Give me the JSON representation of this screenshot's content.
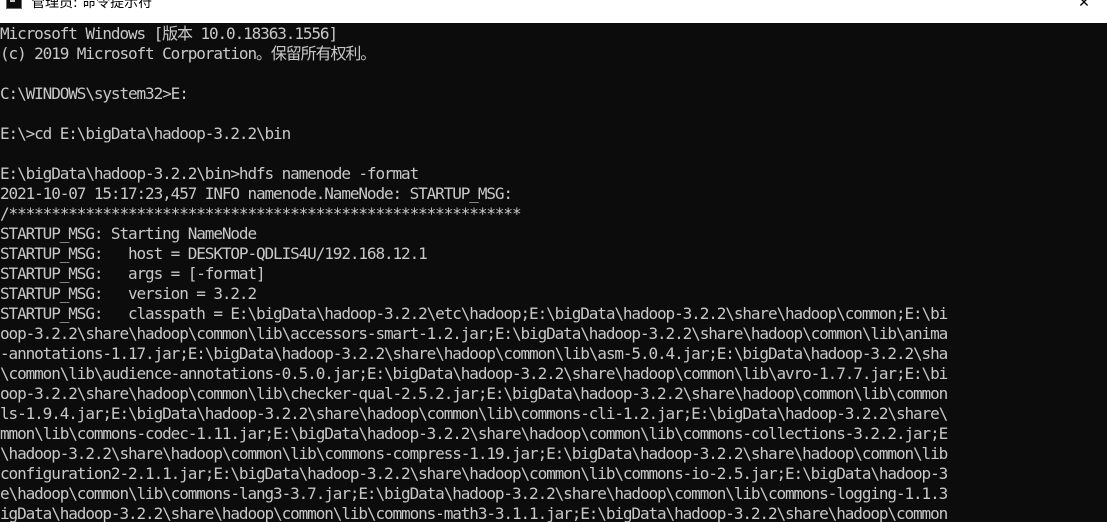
{
  "window": {
    "title": "管理员: 命令提示符",
    "close_glyph": "✕",
    "icon": "cmd-icon"
  },
  "colors": {
    "console_bg": "#0c0c0c",
    "console_fg": "#c8c8c8",
    "titlebar_bg": "#ffffff"
  },
  "console": {
    "lines": [
      "Microsoft Windows [版本 10.0.18363.1556]",
      "(c) 2019 Microsoft Corporation。保留所有权利。",
      "",
      "C:\\WINDOWS\\system32>E:",
      "",
      "E:\\>cd E:\\bigData\\hadoop-3.2.2\\bin",
      "",
      "E:\\bigData\\hadoop-3.2.2\\bin>hdfs namenode -format",
      "2021-10-07 15:17:23,457 INFO namenode.NameNode: STARTUP_MSG:",
      "/************************************************************",
      "STARTUP_MSG: Starting NameNode",
      "STARTUP_MSG:   host = DESKTOP-QDLIS4U/192.168.12.1",
      "STARTUP_MSG:   args = [-format]",
      "STARTUP_MSG:   version = 3.2.2",
      "STARTUP_MSG:   classpath = E:\\bigData\\hadoop-3.2.2\\etc\\hadoop;E:\\bigData\\hadoop-3.2.2\\share\\hadoop\\common;E:\\bi",
      "oop-3.2.2\\share\\hadoop\\common\\lib\\accessors-smart-1.2.jar;E:\\bigData\\hadoop-3.2.2\\share\\hadoop\\common\\lib\\anima",
      "-annotations-1.17.jar;E:\\bigData\\hadoop-3.2.2\\share\\hadoop\\common\\lib\\asm-5.0.4.jar;E:\\bigData\\hadoop-3.2.2\\sha",
      "\\common\\lib\\audience-annotations-0.5.0.jar;E:\\bigData\\hadoop-3.2.2\\share\\hadoop\\common\\lib\\avro-1.7.7.jar;E:\\bi",
      "oop-3.2.2\\share\\hadoop\\common\\lib\\checker-qual-2.5.2.jar;E:\\bigData\\hadoop-3.2.2\\share\\hadoop\\common\\lib\\common",
      "ls-1.9.4.jar;E:\\bigData\\hadoop-3.2.2\\share\\hadoop\\common\\lib\\commons-cli-1.2.jar;E:\\bigData\\hadoop-3.2.2\\share\\",
      "mmon\\lib\\commons-codec-1.11.jar;E:\\bigData\\hadoop-3.2.2\\share\\hadoop\\common\\lib\\commons-collections-3.2.2.jar;E",
      "\\hadoop-3.2.2\\share\\hadoop\\common\\lib\\commons-compress-1.19.jar;E:\\bigData\\hadoop-3.2.2\\share\\hadoop\\common\\lib",
      "configuration2-2.1.1.jar;E:\\bigData\\hadoop-3.2.2\\share\\hadoop\\common\\lib\\commons-io-2.5.jar;E:\\bigData\\hadoop-3",
      "e\\hadoop\\common\\lib\\commons-lang3-3.7.jar;E:\\bigData\\hadoop-3.2.2\\share\\hadoop\\common\\lib\\commons-logging-1.1.3",
      "igData\\hadoop-3.2.2\\share\\hadoop\\common\\lib\\commons-math3-3.1.1.jar;E:\\bigData\\hadoop-3.2.2\\share\\hadoop\\common"
    ]
  }
}
